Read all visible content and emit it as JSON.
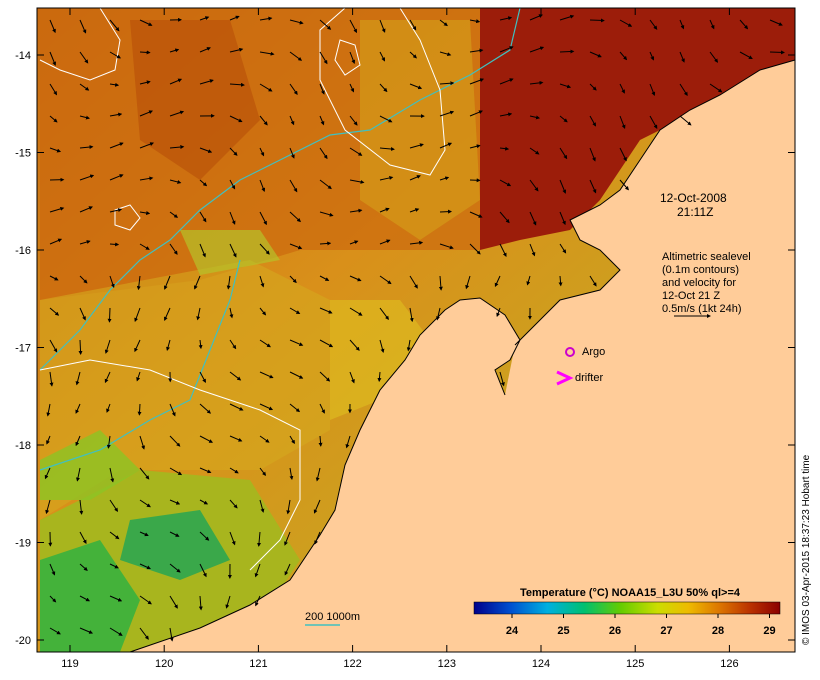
{
  "map": {
    "x_ticks": [
      "119",
      "120",
      "121",
      "122",
      "123",
      "124",
      "125",
      "126"
    ],
    "y_ticks": [
      "-14",
      "-15",
      "-16",
      "-17",
      "-18",
      "-19",
      "-20"
    ],
    "timestamp_line1": "12-Oct-2008",
    "timestamp_line2": "21:11Z",
    "altimetry_note": [
      "Altimetric sealevel",
      "(0.1m contours)",
      "and velocity for",
      "12-Oct 21 Z",
      "0.5m/s (1kt 24h)"
    ],
    "argo_label": "Argo",
    "drifter_label": "drifter",
    "isobath_label": "200  1000m",
    "credit": "© IMOS 03-Apr-2015 18:37:23 Hobart time"
  },
  "colorbar": {
    "title": "Temperature (°C) NOAA15_L3U 50% ql>=4",
    "ticks": [
      "24",
      "25",
      "26",
      "27",
      "28",
      "29"
    ],
    "colors": [
      "#00008b",
      "#0050d0",
      "#00b0e0",
      "#00c070",
      "#66cc00",
      "#ccdd00",
      "#eebb00",
      "#dd7700",
      "#bb3300",
      "#8b0000"
    ]
  },
  "colors": {
    "land": "#ffcc99",
    "isobath": "#40c0c0",
    "sealevel_contour": "#ffffff",
    "argo": "#cc00cc"
  }
}
